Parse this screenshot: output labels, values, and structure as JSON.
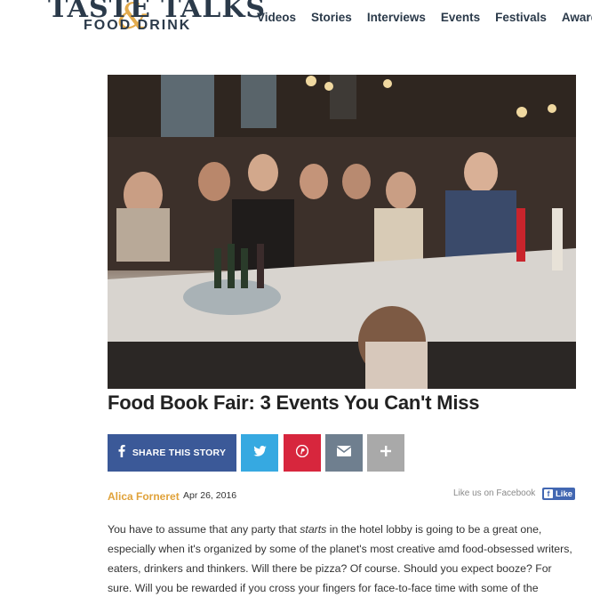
{
  "header": {
    "logo_top": "TASTE TALKS",
    "logo_bottom": "FOOD DRINK",
    "logo_amp": "&",
    "nav": [
      "Videos",
      "Stories",
      "Interviews",
      "Events",
      "Festivals",
      "Awards"
    ]
  },
  "article": {
    "title": "Food Book Fair: 3 Events You Can't Miss",
    "share_label": "SHARE THIS STORY",
    "author": "Alica Forneret",
    "date": "Apr 26, 2016",
    "like_us": "Like us on Facebook",
    "like_button": "Like",
    "body_intro": "You have to assume that any party that ",
    "body_em": "starts",
    "body_rest": " in the hotel lobby is going to be a great one, especially when it's organized by some of the planet's most creative amd food-obsessed writers, eaters, drinkers and thinkers. Will there be pizza? Of course. Should you expect booze? For sure. Will you be rewarded if you cross your fingers for face-to-face time with some of the culinary world's most"
  },
  "icons": {
    "facebook": "facebook-icon",
    "twitter": "twitter-icon",
    "pinterest": "pinterest-icon",
    "email": "email-icon",
    "more": "plus-icon"
  },
  "colors": {
    "brand": "#2b3a4a",
    "accent": "#e0a23a",
    "facebook": "#3b5998",
    "twitter": "#36a9e1",
    "pinterest": "#d7263d",
    "email": "#6f7f8f",
    "more": "#a9a9a9"
  }
}
